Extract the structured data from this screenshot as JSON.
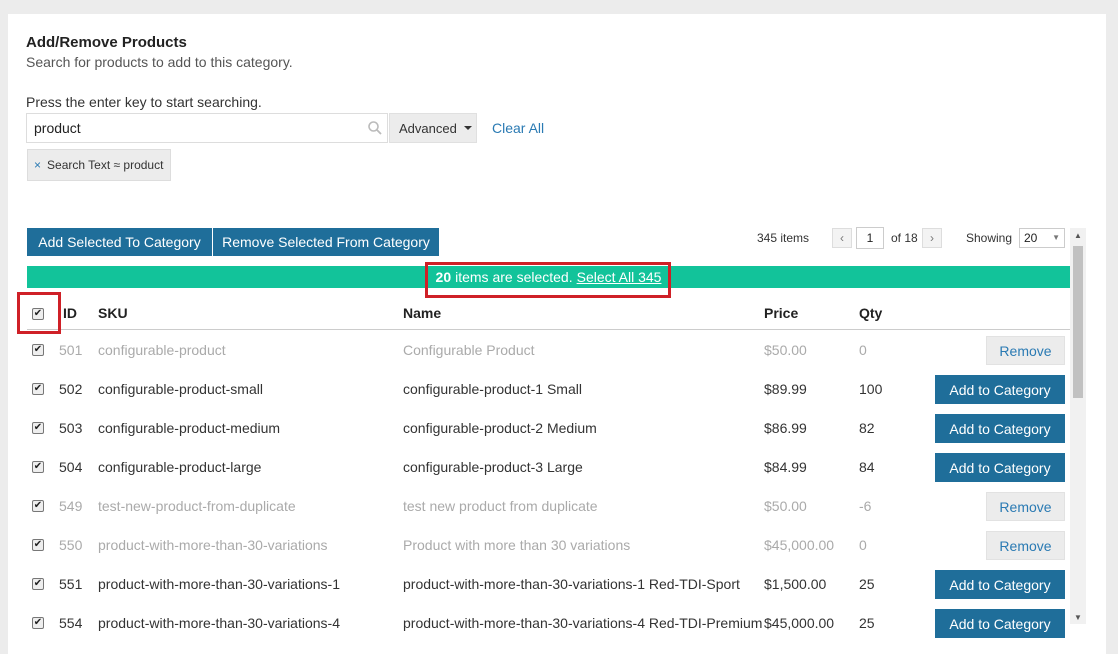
{
  "header": {
    "title": "Add/Remove Products",
    "subtitle": "Search for products to add to this category."
  },
  "search": {
    "hint": "Press the enter key to start searching.",
    "value": "product",
    "placeholder": "",
    "advanced_label": "Advanced",
    "clear_all_label": "Clear All",
    "filter_chip": "Search Text ≈ product",
    "filter_chip_close": "×"
  },
  "toolbar": {
    "add_selected_label": "Add Selected To Category",
    "remove_selected_label": "Remove Selected From Category",
    "items_count": "345 items",
    "page_prev": "‹",
    "page_current": "1",
    "page_of": "of 18",
    "page_next": "›",
    "showing_label": "Showing",
    "page_size": "20",
    "page_size_caret": "▼"
  },
  "selection_banner": {
    "count": "20",
    "text": "items are selected.",
    "link": "Select All 345"
  },
  "table": {
    "columns": {
      "id": "ID",
      "sku": "SKU",
      "name": "Name",
      "price": "Price",
      "qty": "Qty"
    },
    "header_check": "✔",
    "rows": [
      {
        "check": "✔",
        "id": "501",
        "sku": "configurable-product",
        "name": "Configurable Product",
        "price": "$50.00",
        "qty": "0",
        "action": "Remove",
        "muted": true
      },
      {
        "check": "✔",
        "id": "502",
        "sku": "configurable-product-small",
        "name": "configurable-product-1 Small",
        "price": "$89.99",
        "qty": "100",
        "action": "Add to Category",
        "muted": false
      },
      {
        "check": "✔",
        "id": "503",
        "sku": "configurable-product-medium",
        "name": "configurable-product-2 Medium",
        "price": "$86.99",
        "qty": "82",
        "action": "Add to Category",
        "muted": false
      },
      {
        "check": "✔",
        "id": "504",
        "sku": "configurable-product-large",
        "name": "configurable-product-3 Large",
        "price": "$84.99",
        "qty": "84",
        "action": "Add to Category",
        "muted": false
      },
      {
        "check": "✔",
        "id": "549",
        "sku": "test-new-product-from-duplicate",
        "name": "test new product from duplicate",
        "price": "$50.00",
        "qty": "-6",
        "action": "Remove",
        "muted": true
      },
      {
        "check": "✔",
        "id": "550",
        "sku": "product-with-more-than-30-variations",
        "name": "Product with more than 30 variations",
        "price": "$45,000.00",
        "qty": "0",
        "action": "Remove",
        "muted": true
      },
      {
        "check": "✔",
        "id": "551",
        "sku": "product-with-more-than-30-variations-1",
        "name": "product-with-more-than-30-variations-1 Red-TDI-Sport",
        "price": "$1,500.00",
        "qty": "25",
        "action": "Add to Category",
        "muted": false
      },
      {
        "check": "✔",
        "id": "554",
        "sku": "product-with-more-than-30-variations-4",
        "name": "product-with-more-than-30-variations-4 Red-TDI-Premium",
        "price": "$45,000.00",
        "qty": "25",
        "action": "Add to Category",
        "muted": false
      }
    ]
  },
  "scrollbar": {
    "up": "▲",
    "down": "▼"
  },
  "colors": {
    "primary_button": "#1f6e9a",
    "selection_banner": "#12c39a",
    "highlight_box": "#cf2027",
    "link": "#2a7ab3"
  }
}
